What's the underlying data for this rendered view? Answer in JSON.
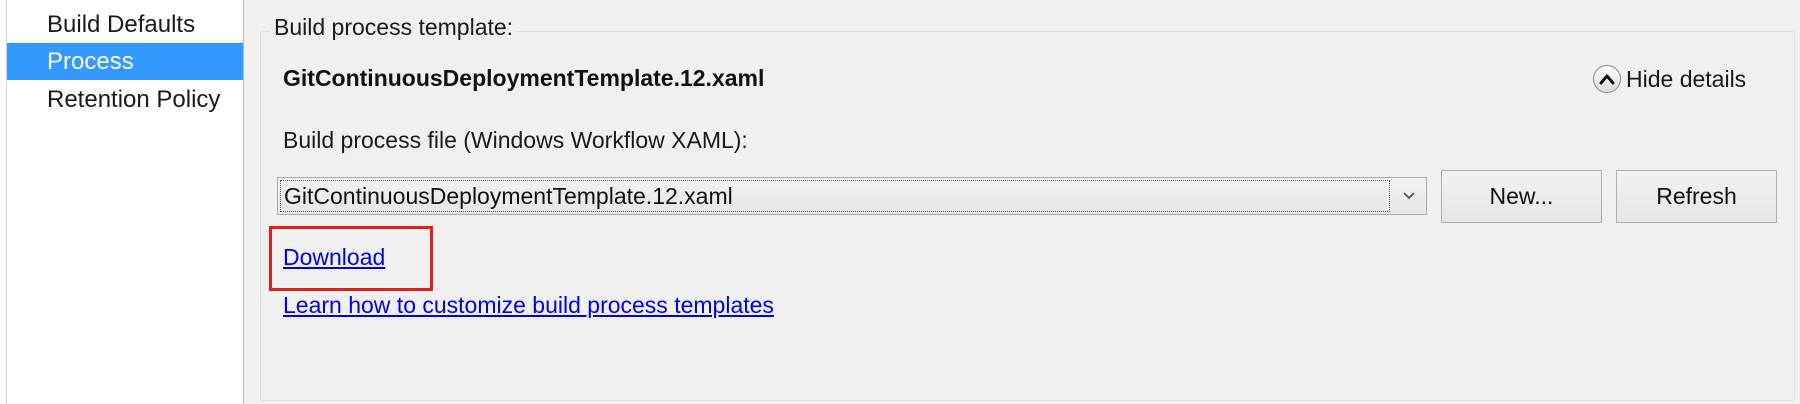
{
  "sidebar": {
    "items": [
      {
        "label": "Build Defaults",
        "selected": false
      },
      {
        "label": "Process",
        "selected": true
      },
      {
        "label": "Retention Policy",
        "selected": false
      }
    ]
  },
  "process": {
    "group_title": "Build process template:",
    "template_name": "GitContinuousDeploymentTemplate.12.xaml",
    "hide_details_label": "Hide details",
    "file_label": "Build process file (Windows Workflow XAML):",
    "file_value": "GitContinuousDeploymentTemplate.12.xaml",
    "new_label": "New...",
    "refresh_label": "Refresh",
    "download_label": "Download",
    "learn_label": "Learn how to customize build process templates"
  },
  "colors": {
    "selection": "#3399ff",
    "link": "#0000ee",
    "highlight": "#e0201b",
    "panel_bg": "#f0f0f0"
  },
  "icons": {
    "collapse": "chevron-up-icon",
    "dropdown": "chevron-down-icon"
  }
}
